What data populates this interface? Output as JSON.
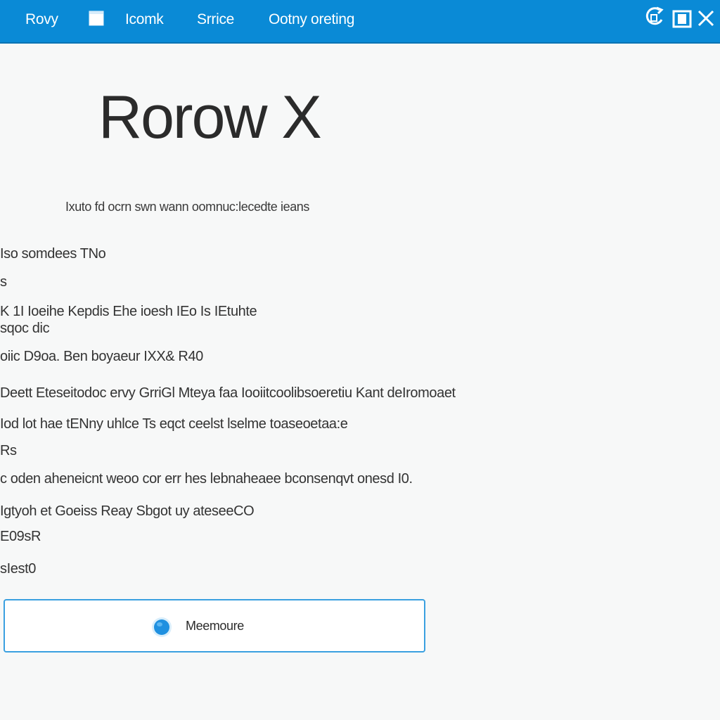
{
  "topbar": {
    "nav": [
      {
        "label": "Rovy"
      },
      {
        "label": "Icomk"
      },
      {
        "label": "Srrice"
      },
      {
        "label": "Ootny oreting"
      }
    ],
    "accent": "#0a8ad6",
    "icons": [
      "square-icon",
      "refresh-icon",
      "window-icon",
      "close-icon"
    ]
  },
  "main": {
    "title": "Rorow X",
    "subtitle": "Ixuto fd ocrn swn wann oomnuc:lecedte ieans",
    "lines": [
      "Iso somdees TNo",
      "s",
      "K 1I Ioeihe  Kepdis Ehe ioesh IEo Is IEtuhte",
      "sqoc dic",
      "oiic D9oa.  Ben  boyaeur IXX& R40",
      "Deett  Eteseitodoc  ervy  GrriGl  Mteya  faa  Iooiitcoolibsoeretiu  Kant  deIromoaet",
      "Iod  lot  hae  tENny  uhlce  Ts  eqct  ceelst  lselme  toaseoetaa:e",
      "Rs",
      "c oden  aheneicnt  weoo  cor  err  hes  lebnaheaee  bconsenqvt  onesd  I0.",
      "Igtyoh  et  Goeiss  Reay  Sbgot  uy  ateseeCO",
      "E09sR",
      "sIest0"
    ]
  },
  "action": {
    "label": "Meemoure",
    "color": "#3aa0e0",
    "icon": "globe-icon"
  }
}
